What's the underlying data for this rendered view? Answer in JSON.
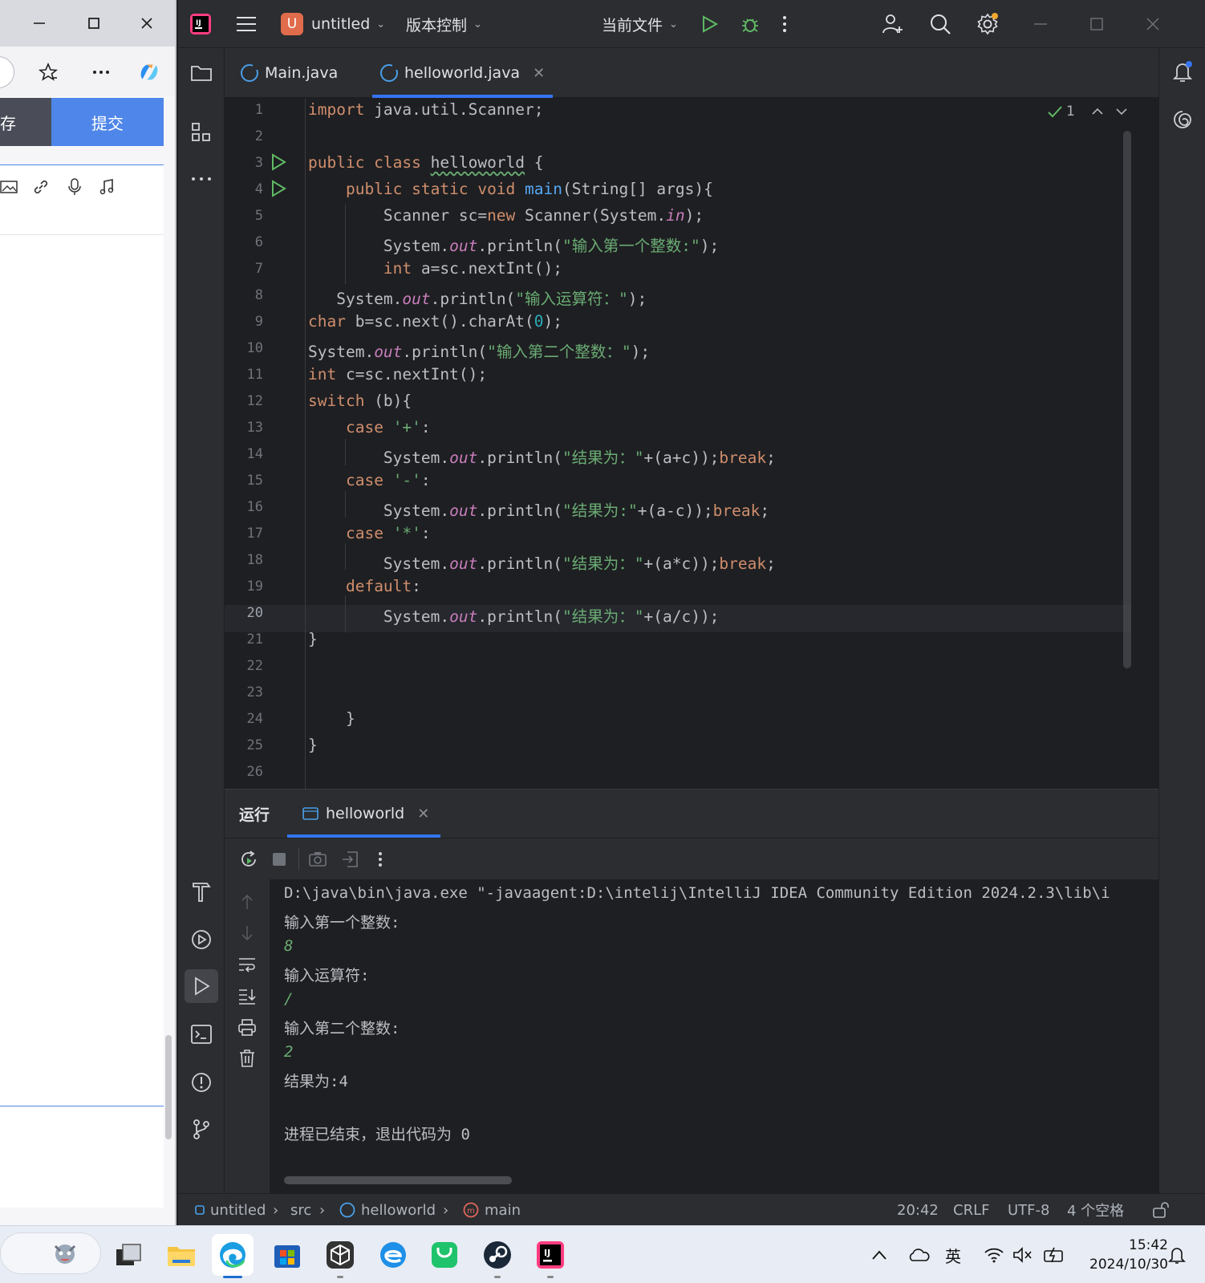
{
  "browser": {
    "save_tab_label": "存",
    "submit_label": "提交"
  },
  "ide": {
    "project_name": "untitled",
    "project_badge": "U",
    "vcs_menu": "版本控制",
    "run_config": "当前文件",
    "tabs": [
      {
        "label": "Main.java",
        "active": false
      },
      {
        "label": "helloworld.java",
        "active": true
      }
    ],
    "inspection_count": "1",
    "line_numbers": [
      "1",
      "2",
      "3",
      "4",
      "5",
      "6",
      "7",
      "8",
      "9",
      "10",
      "11",
      "12",
      "13",
      "14",
      "15",
      "16",
      "17",
      "18",
      "19",
      "20",
      "21",
      "22",
      "23",
      "24",
      "25",
      "26"
    ],
    "current_line": "20",
    "run_panel": {
      "title": "运行",
      "tab_label": "helloworld"
    },
    "console": [
      {
        "text": "D:\\java\\bin\\java.exe \"-javaagent:D:\\intelij\\IntelliJ IDEA Community Edition 2024.2.3\\lib\\i",
        "input": false
      },
      {
        "text": "输入第一个整数:",
        "input": false
      },
      {
        "text": "8",
        "input": true
      },
      {
        "text": "输入运算符:",
        "input": false
      },
      {
        "text": "/",
        "input": true
      },
      {
        "text": "输入第二个整数:",
        "input": false
      },
      {
        "text": "2",
        "input": true
      },
      {
        "text": "结果为:4",
        "input": false
      },
      {
        "text": "",
        "input": false
      },
      {
        "text": "进程已结束，退出代码为 0",
        "input": false
      }
    ],
    "status_bar": {
      "breadcrumb": [
        "untitled",
        "src",
        "helloworld",
        "main"
      ],
      "position": "20:42",
      "line_sep": "CRLF",
      "encoding": "UTF-8",
      "indent": "4 个空格"
    }
  },
  "taskbar": {
    "ime": "英",
    "time": "15:42",
    "date": "2024/10/30"
  },
  "colors": {
    "accent": "#3574f0",
    "keyword": "#cf8e6d",
    "string": "#6aab73",
    "function": "#56a8f5",
    "field": "#c77dbb",
    "run_green": "#5fb865"
  }
}
